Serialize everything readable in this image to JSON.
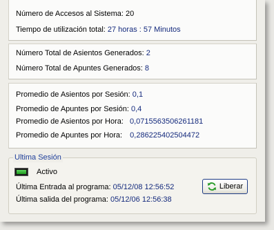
{
  "stats_access": {
    "accesos_label": "Número de Accesos al Sistema:",
    "accesos_value": "20",
    "tiempo_label": "Tiempo de utilización total:",
    "tiempo_value": "27 horas : 57 Minutos"
  },
  "stats_totals": {
    "asientos_label": "Número Total de Asientos Generados:",
    "asientos_value": "2",
    "apuntes_label": "Número Total de Apuntes Generados:",
    "apuntes_value": "8"
  },
  "stats_averages": {
    "asientos_sesion_label": "Promedio de Asientos por Sesión:",
    "asientos_sesion_value": "0,1",
    "apuntes_sesion_label": "Promedio de Apuntes por Sesión:",
    "apuntes_sesion_value": "0,4",
    "asientos_hora_label": "Promedio de Asientos por Hora:",
    "asientos_hora_value": "0,0715563506261181",
    "apuntes_hora_label": "Promedio de Apuntes por Hora:",
    "apuntes_hora_value": "0,286225402504472"
  },
  "ultima_sesion": {
    "title": "Ultima Sesión",
    "status_label": "Activo",
    "status_icon": "status-active-icon",
    "entrada_label": "Última Entrada al programa:",
    "entrada_value": "05/12/08 12:56:52",
    "salida_label": "Última salida del programa:",
    "salida_value": "05/12/06 12:56:38",
    "button_label": "Liberar",
    "button_icon": "refresh-icon"
  },
  "colors": {
    "value_text": "#13297c",
    "group_title": "#1f3f9a",
    "status_green": "#3cc03c",
    "refresh_green": "#2a9d2a"
  }
}
